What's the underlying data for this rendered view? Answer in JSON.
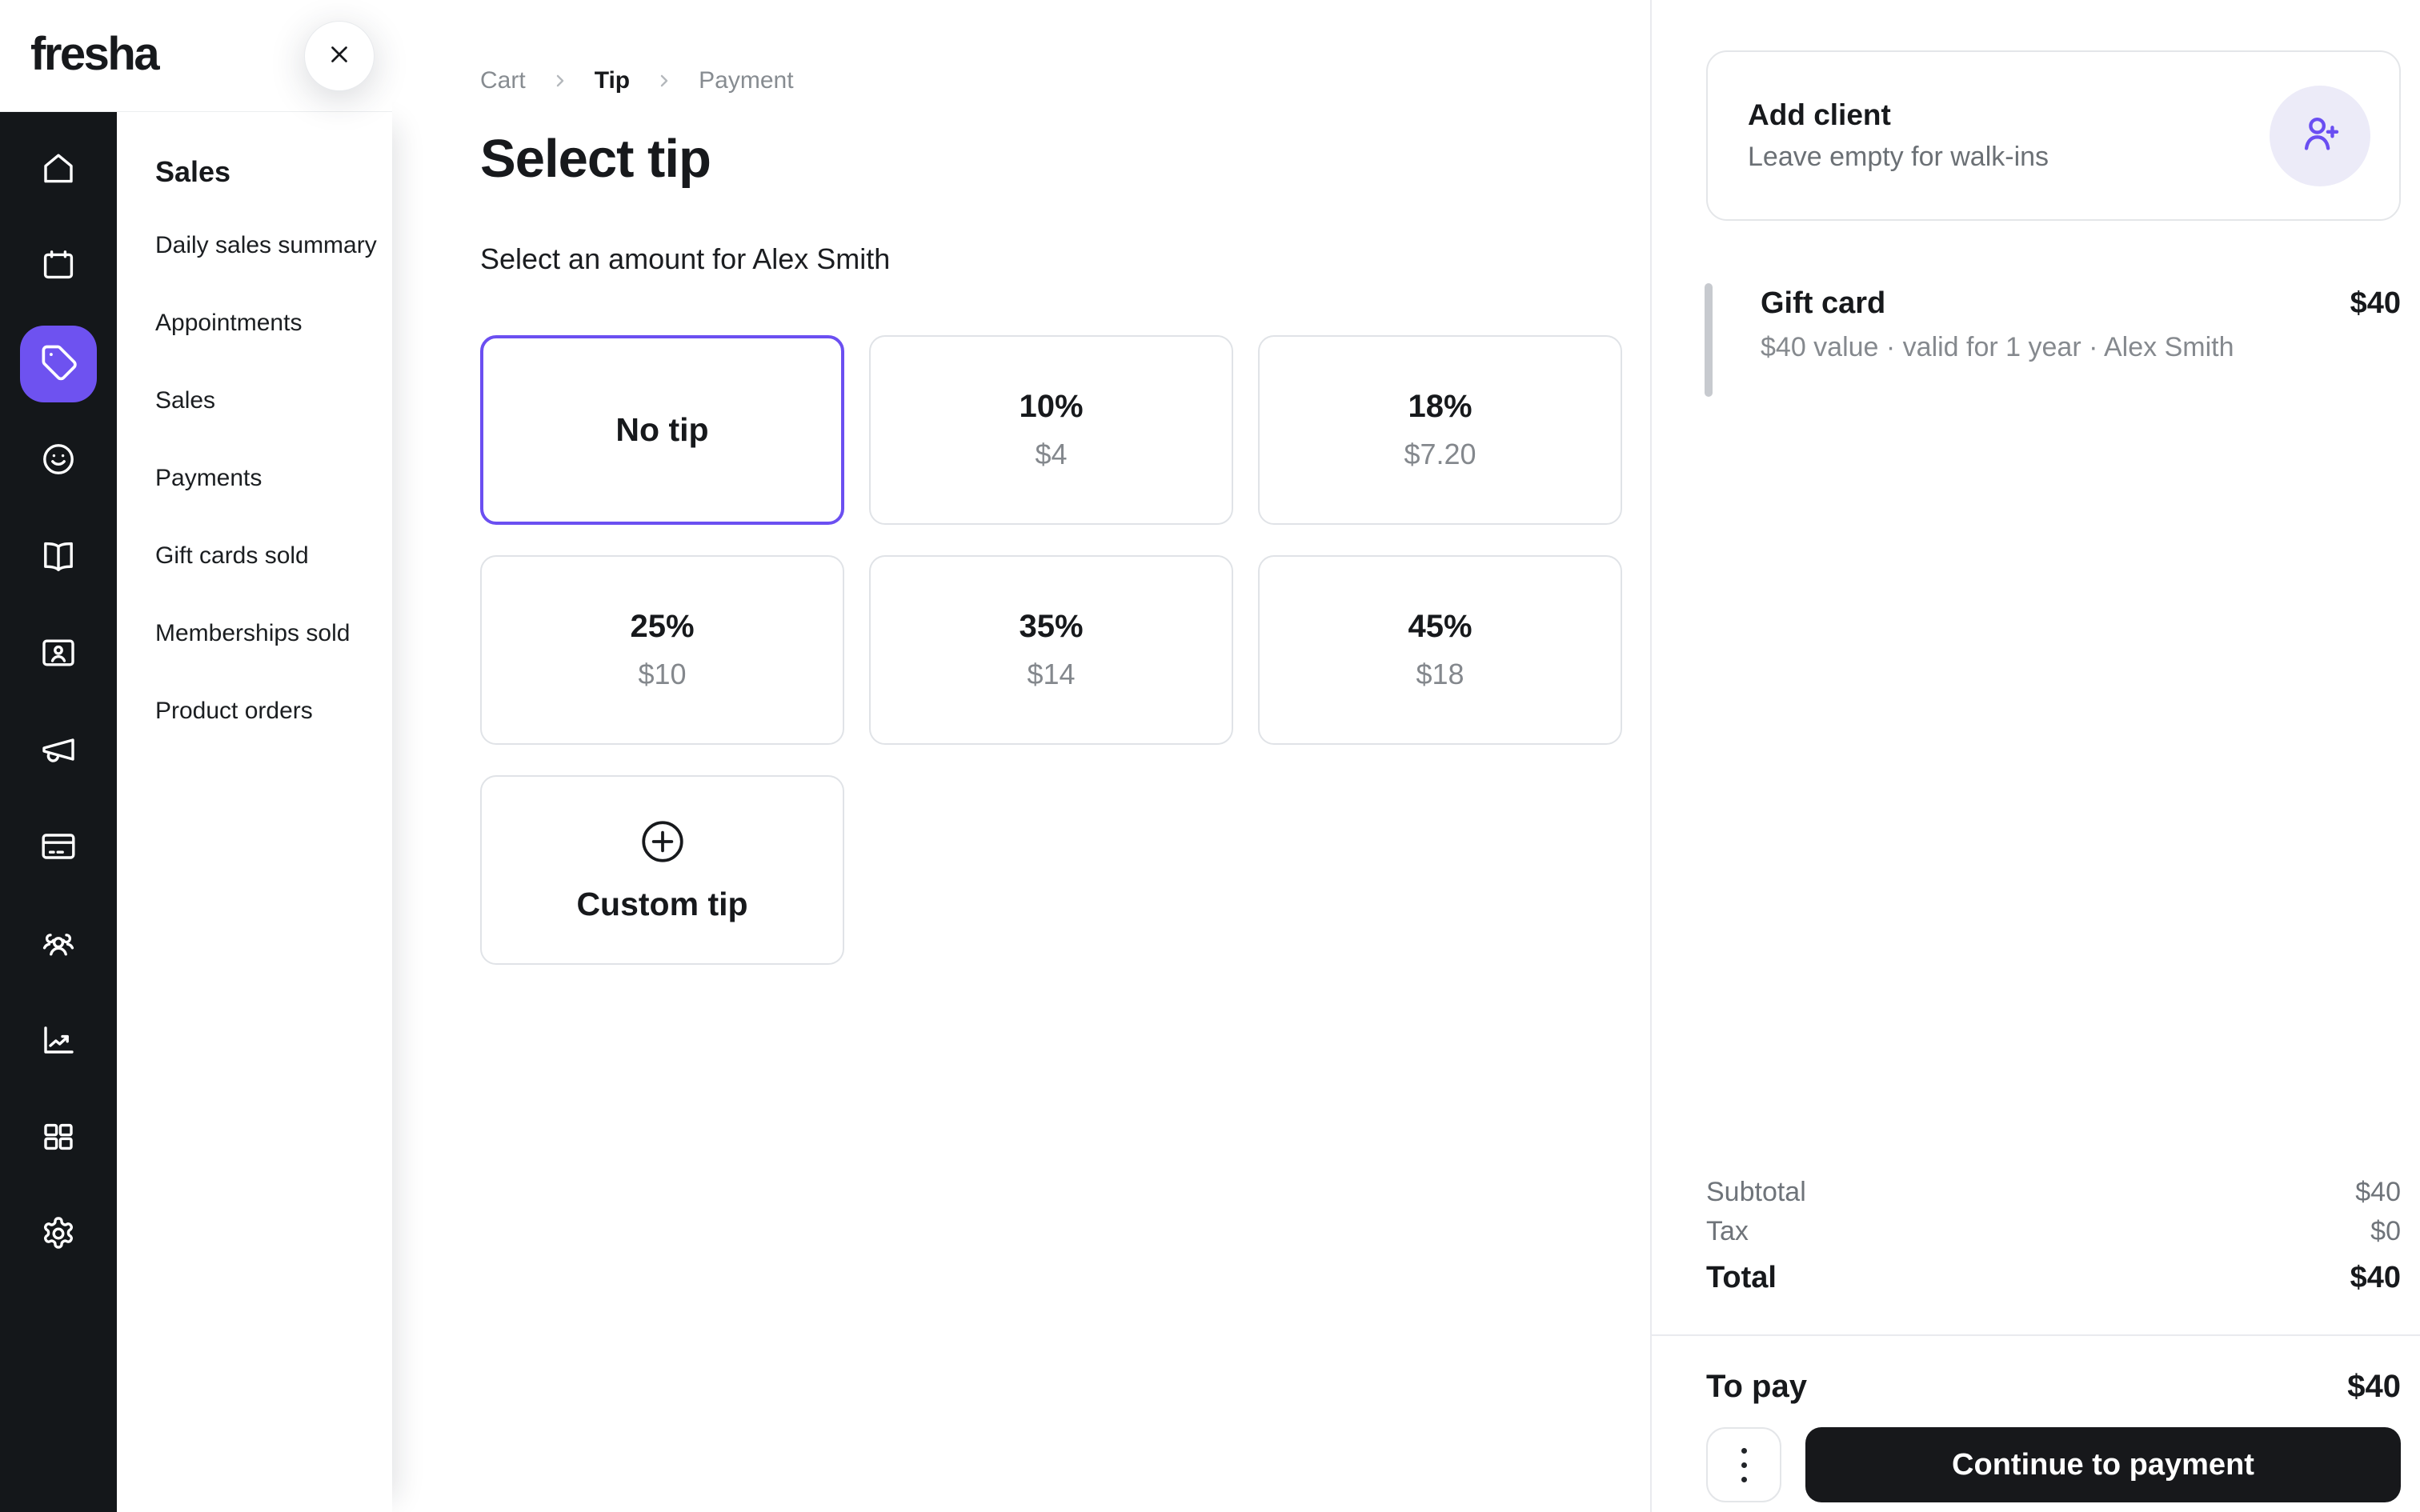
{
  "brand": {
    "logo": "fresha",
    "accent_purple": "#6e52f0",
    "rail_background": "#14171a",
    "selected_border": "#6b4ff1"
  },
  "nav_rail": {
    "items": [
      {
        "icon": "home-icon"
      },
      {
        "icon": "calendar-icon"
      },
      {
        "icon": "tag-icon",
        "active": true
      },
      {
        "icon": "smiley-icon"
      },
      {
        "icon": "book-open-icon"
      },
      {
        "icon": "contact-card-icon"
      },
      {
        "icon": "megaphone-icon"
      },
      {
        "icon": "credit-card-icon"
      },
      {
        "icon": "team-icon"
      },
      {
        "icon": "chart-icon"
      },
      {
        "icon": "grid-icon"
      },
      {
        "icon": "gear-icon"
      }
    ]
  },
  "sidebar": {
    "heading": "Sales",
    "items": [
      "Daily sales summary",
      "Appointments",
      "Sales",
      "Payments",
      "Gift cards sold",
      "Memberships sold",
      "Product orders"
    ]
  },
  "breadcrumb": {
    "items": [
      {
        "label": "Cart"
      },
      {
        "label": "Tip",
        "current": true
      },
      {
        "label": "Payment"
      }
    ]
  },
  "main": {
    "title": "Select tip",
    "subtitle": "Select an amount for Alex Smith",
    "tip_options": [
      {
        "label": "No tip",
        "selected": true
      },
      {
        "percent": "10%",
        "amount": "$4"
      },
      {
        "percent": "18%",
        "amount": "$7.20"
      },
      {
        "percent": "25%",
        "amount": "$10"
      },
      {
        "percent": "35%",
        "amount": "$14"
      },
      {
        "percent": "45%",
        "amount": "$18"
      },
      {
        "label": "Custom tip",
        "icon": "plus-circle-icon"
      }
    ]
  },
  "client_card": {
    "title": "Add client",
    "subtitle": "Leave empty for walk-ins",
    "icon": "user-plus-icon"
  },
  "order": {
    "items": [
      {
        "name": "Gift card",
        "price": "$40",
        "details": "$40 value · valid for 1 year · Alex Smith"
      }
    ],
    "summary": [
      {
        "label": "Subtotal",
        "value": "$40"
      },
      {
        "label": "Tax",
        "value": "$0"
      },
      {
        "label": "Total",
        "value": "$40"
      }
    ],
    "to_pay_label": "To pay",
    "to_pay_value": "$40",
    "continue_label": "Continue to payment"
  }
}
